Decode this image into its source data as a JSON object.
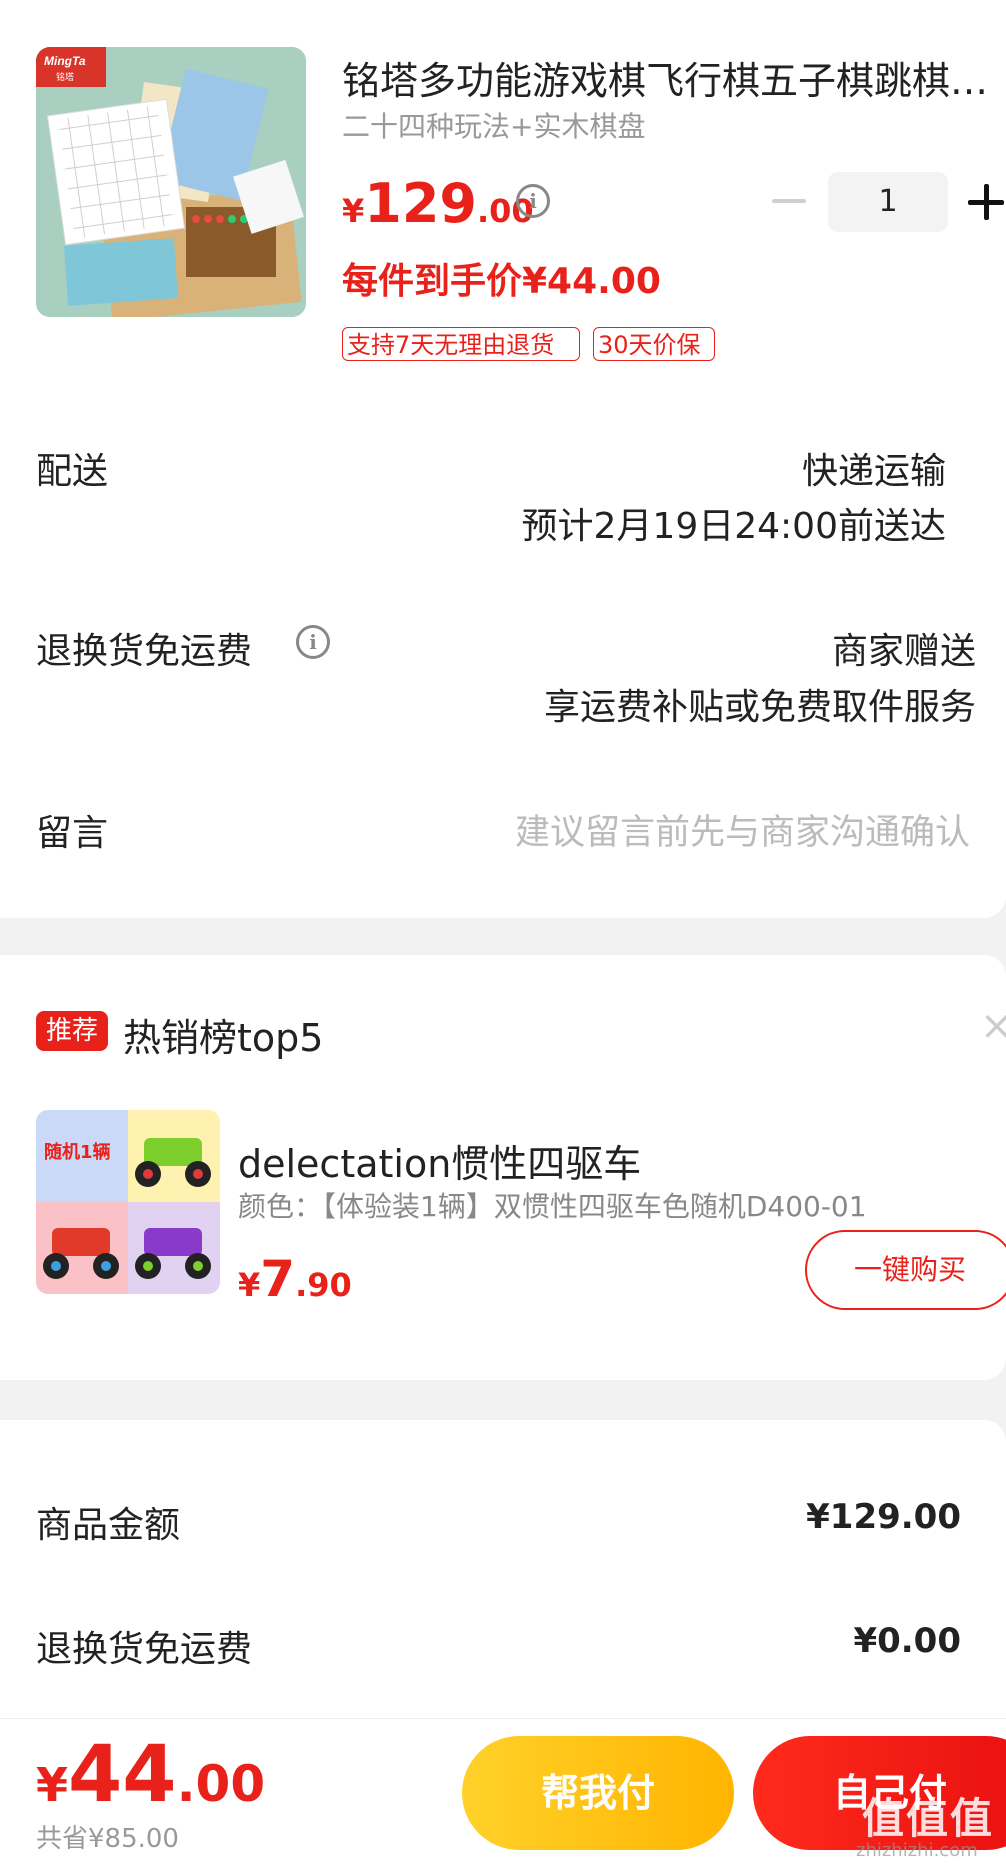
{
  "product": {
    "title": "铭塔多功能游戏棋飞行棋五子棋跳棋…",
    "subtitle": "二十四种玩法+实木棋盘",
    "price_currency": "¥",
    "price_int": "129",
    "price_dec": ".00",
    "quantity": "1",
    "each_price": "每件到手价¥44.00",
    "tags": [
      "支持7天无理由退货",
      "30天价保"
    ],
    "image_brand": "MingTa"
  },
  "delivery": {
    "label": "配送",
    "method": "快递运输",
    "eta": "预计2月19日24:00前送达"
  },
  "return_shipping": {
    "label": "退换货免运费",
    "value": "商家赠送",
    "desc": "享运费补贴或免费取件服务"
  },
  "message": {
    "label": "留言",
    "placeholder": "建议留言前先与商家沟通确认"
  },
  "recommend": {
    "badge": "推荐",
    "title": "热销榜top5",
    "close": "×",
    "item": {
      "image_label": "随机1辆",
      "name": "delectation惯性四驱车",
      "spec": "颜色：【体验装1辆】双惯性四驱车色随机D400-01",
      "price_currency": "¥",
      "price_int": "7",
      "price_dec": ".90",
      "buy_label": "一键购买"
    }
  },
  "summary": {
    "goods_label": "商品金额",
    "goods_value": "¥129.00",
    "return_label": "退换货免运费",
    "return_value": "¥0.00"
  },
  "footer": {
    "total_currency": "¥",
    "total_int": "44",
    "total_dec": ".00",
    "saved": "共省¥85.00",
    "help_pay": "帮我付",
    "self_pay": "自己付",
    "watermark": "值值值",
    "watermark_sub": "zhizhizhi.com"
  },
  "colors": {
    "accent": "#e8221a",
    "help_button": "#ffc20e"
  }
}
